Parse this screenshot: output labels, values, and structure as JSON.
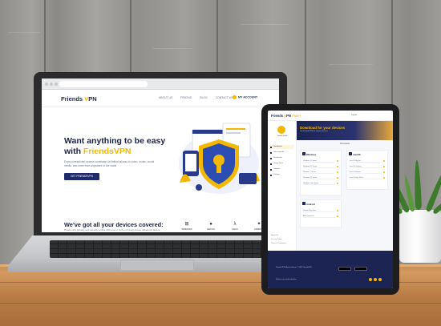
{
  "laptop_site": {
    "brand_prefix": "Friends ",
    "brand_v": "V",
    "brand_suffix": "PN",
    "nav": [
      "ABOUT US",
      "PRICING",
      "BLOG",
      "CONTACT US"
    ],
    "account": "MY ACCOUNT",
    "hero_title_line1": "Want anything to be easy",
    "hero_title_with": "with ",
    "hero_title_brand": "FriendsVPN",
    "hero_sub": "Enjoy unrestricted access worldwide Unlimited access to video, music, social media, and more from anywhere in the world",
    "cta": "GET FRIENDSVPN",
    "devices_title": "We’ve got all your devices covered:",
    "devices_sub": "Protect any privacy and security online with one or more our easy-to-use ultrasonic device:",
    "os": [
      {
        "icon": "windows-icon",
        "glyph": "⊞",
        "label": "WINDOWS"
      },
      {
        "icon": "apple-icon",
        "glyph": "",
        "label": "MACOS"
      },
      {
        "icon": "linux-icon",
        "glyph": "λ",
        "label": "LINUX"
      },
      {
        "icon": "android-icon",
        "glyph": "✦",
        "label": "ANDROID"
      }
    ]
  },
  "tablet_app": {
    "brand_prefix": "Friends ",
    "brand_v": "V",
    "brand_suffix": "PN",
    "brand_tag": "Panel",
    "header_right": "Logout",
    "user_name": "Joseph Smith",
    "sidebar": [
      "Dashboard",
      "Subscriptions",
      "Downloads",
      "Usage Stats",
      "Tutorials",
      "Settings"
    ],
    "sidebar_footer": [
      "About Us",
      "Privacy Policy",
      "Terms & Conditions"
    ],
    "banner_title": "Download for your devices",
    "banner_sub": "Get FriendsVPN for all your devices",
    "downloads_label": "Downloads",
    "cards": [
      {
        "title": "Windows",
        "rows": [
          "Windows 10 Setup",
          "Windows 8.1 Setup",
          "Windows 7 Setup",
          "Windows XP Setup",
          "Windows Vista Setup"
        ]
      },
      {
        "title": "macOS",
        "rows": [
          "macOS Big Sur",
          "macOS Catalina",
          "macOS Mojave",
          "macOS High Sierra"
        ]
      },
      {
        "title": "Android",
        "rows": [
          "Google Play Store",
          "APK Download"
        ]
      }
    ],
    "footer_text": "Friends VPN official software. © 2021 FriendsVPN",
    "footer_bottom": "Follow us on social networks"
  },
  "colors": {
    "navy": "#1c2244",
    "accent": "#f5b800",
    "button": "#1f2a6a"
  }
}
